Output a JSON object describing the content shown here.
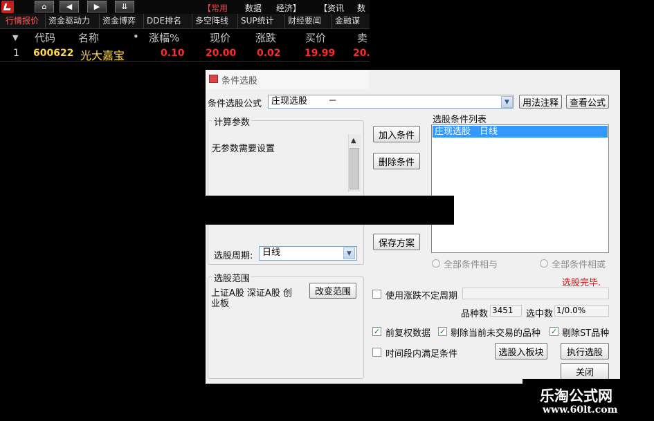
{
  "toolbar": {
    "nav_icons": [
      "home-icon",
      "arrow-left-icon",
      "arrow-right-icon",
      "double-chevron-down-icon"
    ],
    "tabs": [
      {
        "label": "【常用",
        "active": true
      },
      {
        "label": "数据",
        "active": false
      },
      {
        "label": "经济】",
        "active": false
      },
      {
        "label": "【资讯",
        "active": false
      },
      {
        "label": "数",
        "active": false
      }
    ]
  },
  "subtabs": [
    {
      "label": "行情报价",
      "active": true
    },
    {
      "label": "资金驱动力",
      "active": false
    },
    {
      "label": "资金博弈",
      "active": false
    },
    {
      "label": "DDE排名",
      "active": false
    },
    {
      "label": "多空阵线",
      "active": false
    },
    {
      "label": "SUP统计",
      "active": false
    },
    {
      "label": "财经要闻",
      "active": false
    },
    {
      "label": "金融谋",
      "active": false
    }
  ],
  "table": {
    "headers": [
      "代码",
      "名称",
      "•",
      "涨幅%",
      "现价",
      "涨跌",
      "买价",
      "卖"
    ],
    "rows": [
      {
        "index": "1",
        "code": "600622",
        "name": "光大嘉宝",
        "change_pct": "0.10",
        "price": "20.00",
        "change": "0.02",
        "bid": "19.99",
        "ask": "20."
      }
    ]
  },
  "dialog": {
    "title": "条件选股",
    "formula_label": "条件选股公式",
    "formula_value": "庄现选股　　 －",
    "usage_button": "用法注释",
    "view_formula_button": "查看公式",
    "params_group_title": "计算参数",
    "params_text": "无参数需要设置",
    "add_condition_button": "加入条件",
    "delete_condition_button": "删除条件",
    "save_plan_button": "保存方案",
    "condition_list_label": "选股条件列表",
    "condition_items": [
      "庄现选股　日线"
    ],
    "period_label": "选股周期:",
    "period_value": "日线",
    "radio_and_label": "全部条件相与",
    "radio_or_label": "全部条件相或",
    "status_text": "选股完毕.",
    "range_group_title": "选股范围",
    "range_text_line1": "上证A股 深证A股 创",
    "range_text_line2": "业板",
    "change_range_button": "改变范围",
    "use_uncertain_period_label": "使用涨跌不定周期",
    "stock_count_label": "品种数",
    "stock_count_value": "3451",
    "selected_count_label": "选中数",
    "selected_count_value": "1/0.0%",
    "prior_adjust_label": "前复权数据",
    "exclude_untraded_label": "剔除当前未交易的品种",
    "exclude_st_label": "剔除ST品种",
    "time_range_label": "时间段内满足条件",
    "add_to_block_button": "选股入板块",
    "execute_button": "执行选股",
    "close_button": "关闭"
  },
  "watermark": {
    "name": "乐淘公式网",
    "url": "www.60lt.com"
  },
  "colors": {
    "up_red": "#ff2a2a",
    "code_yellow": "#ffd84a",
    "status_red": "#d01010",
    "selection_blue": "#3399ff"
  }
}
